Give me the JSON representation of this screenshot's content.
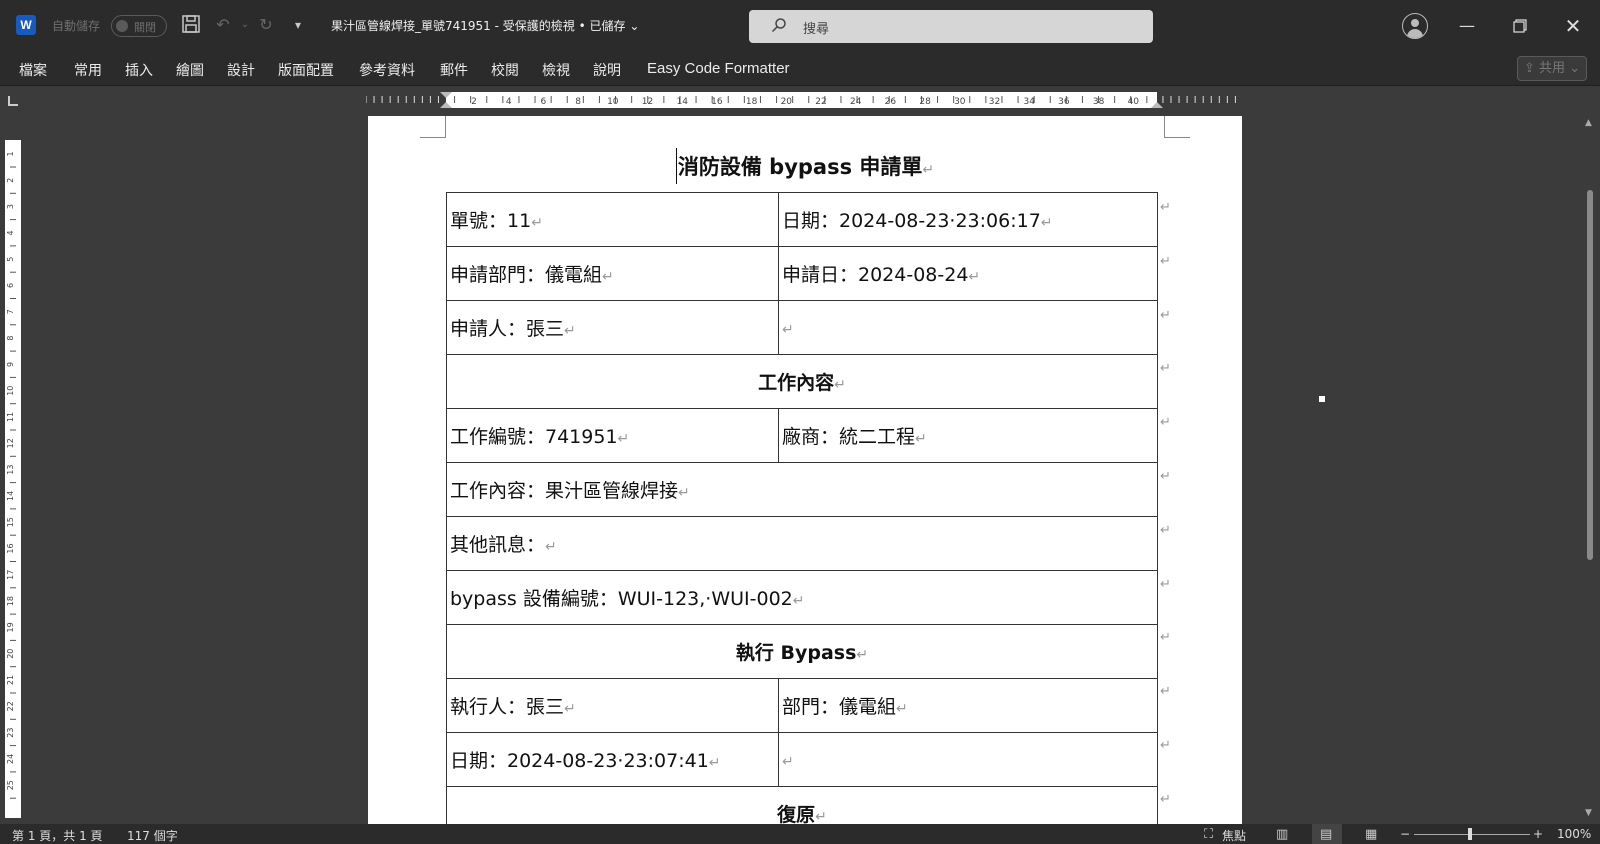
{
  "titlebar": {
    "autosave_label": "自動儲存",
    "autosave_state": "關閉",
    "document_title": "果汁區管線焊接_單號741951  -  受保護的檢視 • 已儲存",
    "search_placeholder": "搜尋",
    "app_icon": "word-icon"
  },
  "ribbon": {
    "tabs": [
      "檔案",
      "常用",
      "插入",
      "繪圖",
      "設計",
      "版面配置",
      "參考資料",
      "郵件",
      "校閱",
      "檢視",
      "說明",
      "Easy Code Formatter"
    ],
    "share_label": "共用"
  },
  "document": {
    "heading": "消防設備 bypass 申請單",
    "para_mark": "↵",
    "rows": [
      {
        "cells": [
          "單號：11",
          "日期：2024-08-23·23:06:17"
        ]
      },
      {
        "cells": [
          "申請部門：儀電組",
          "申請日：2024-08-24"
        ]
      },
      {
        "cells": [
          "申請人：張三",
          ""
        ]
      },
      {
        "header": "工作內容"
      },
      {
        "cells": [
          "工作編號：741951",
          "廠商：統二工程"
        ]
      },
      {
        "full": "工作內容：果汁區管線焊接"
      },
      {
        "full": "其他訊息："
      },
      {
        "full": "bypass 設備編號：WUI-123,·WUI-002"
      },
      {
        "header": "執行 Bypass"
      },
      {
        "cells": [
          "執行人：張三",
          "部門：儀電組"
        ]
      },
      {
        "cells": [
          "日期：2024-08-23·23:07:41",
          ""
        ]
      },
      {
        "header": "復原"
      }
    ]
  },
  "statusbar": {
    "page_info": "第 1 頁，共 1 頁",
    "word_count": "117 個字",
    "focus_label": "焦點",
    "zoom": "100%",
    "zoom_minus": "−",
    "zoom_plus": "+"
  },
  "ruler": {
    "h_labels": [
      "2",
      "4",
      "6",
      "8",
      "10",
      "12",
      "14",
      "16",
      "18",
      "20",
      "22",
      "24",
      "26",
      "28",
      "30",
      "32",
      "34",
      "36",
      "38",
      "40"
    ],
    "v_labels": [
      "1",
      "2",
      "3",
      "4",
      "5",
      "6",
      "7",
      "8",
      "9",
      "10",
      "11",
      "12",
      "13",
      "14",
      "15",
      "16",
      "17",
      "18",
      "19",
      "20",
      "21",
      "22",
      "23",
      "24",
      "25"
    ]
  }
}
